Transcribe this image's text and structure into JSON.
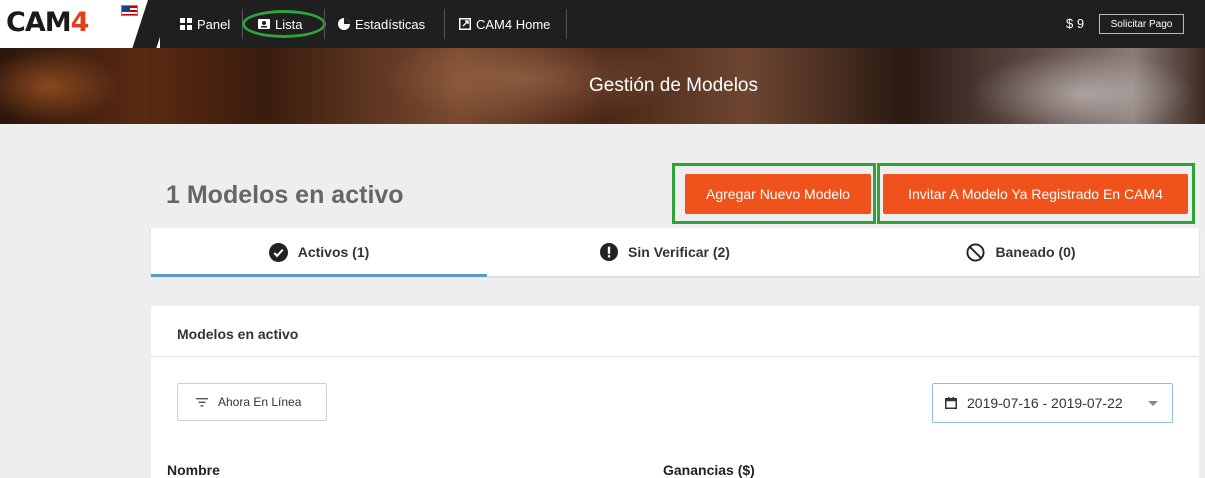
{
  "logo": {
    "text_main": "CAM",
    "text_accent": "4"
  },
  "nav": {
    "items": [
      {
        "label": "Panel",
        "icon": "grid-icon"
      },
      {
        "label": "Lista",
        "icon": "id-card-icon"
      },
      {
        "label": "Estadísticas",
        "icon": "pie-chart-icon"
      },
      {
        "label": "CAM4 Home",
        "icon": "external-link-icon"
      }
    ],
    "balance": "$ 9",
    "payout_button": "Solicitar Pago"
  },
  "banner": {
    "title": "Gestión de Modelos"
  },
  "heading": "1 Modelos en activo",
  "actions": {
    "add_model": "Agregar Nuevo Modelo",
    "invite_model": "Invitar A Modelo Ya Registrado En CAM4"
  },
  "tabs": [
    {
      "label": "Activos (1)",
      "icon": "check-circle-icon",
      "active": true
    },
    {
      "label": "Sin Verificar (2)",
      "icon": "exclamation-circle-icon",
      "active": false
    },
    {
      "label": "Baneado (0)",
      "icon": "ban-icon",
      "active": false
    }
  ],
  "panel": {
    "title": "Modelos en activo",
    "filter_label": "Ahora En Línea",
    "date_range": "2019-07-16 - 2019-07-22",
    "columns": [
      "Nombre",
      "Ganancias ($)"
    ]
  },
  "colors": {
    "accent_orange": "#f0521c",
    "highlight_green": "#2ea33a",
    "tab_underline": "#5b9bc7",
    "topbar": "#1f1f1f"
  }
}
